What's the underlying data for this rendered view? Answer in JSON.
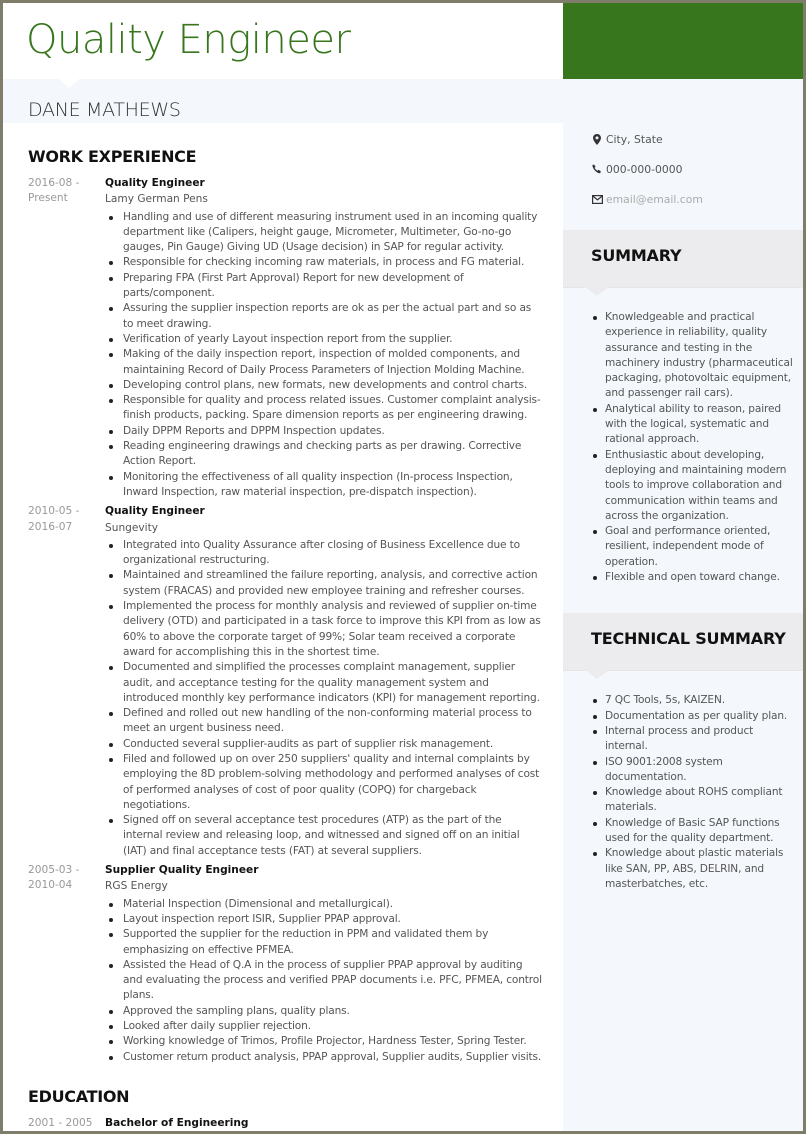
{
  "header": {
    "title": "Quality Engineer",
    "name": "DANE MATHEWS",
    "accent_color": "#38761d"
  },
  "contact": {
    "location": "City, State",
    "phone": "000-000-0000",
    "email": "email@email.com",
    "location_icon": "map-pin-icon",
    "phone_icon": "phone-icon",
    "email_icon": "envelope-icon"
  },
  "work_experience": {
    "heading": "WORK EXPERIENCE",
    "entries": [
      {
        "date_start": "2016-08 -",
        "date_end": "Present",
        "role": "Quality Engineer",
        "company": "Lamy German Pens",
        "bullets": [
          "Handling and use of different measuring instrument used in an incoming quality department like (Calipers, height gauge, Micrometer, Multimeter, Go-no-go gauges, Pin Gauge) Giving UD (Usage decision) in SAP for regular activity.",
          "Responsible for checking incoming raw materials, in process and FG material.",
          "Preparing FPA (First Part Approval) Report for new development of parts/component.",
          "Assuring the supplier inspection reports are ok as per the actual part and so as to meet drawing.",
          "Verification of yearly Layout inspection report from the supplier.",
          "Making of the daily inspection report, inspection of molded components, and maintaining Record of Daily Process Parameters of Injection Molding Machine.",
          "Developing control plans, new formats, new developments and control charts.",
          "Responsible for quality and process related issues. Customer complaint analysis-finish products, packing. Spare dimension reports as per engineering drawing.",
          "Daily DPPM Reports and DPPM Inspection updates.",
          "Reading engineering drawings and checking parts as per drawing. Corrective Action Report.",
          "Monitoring the effectiveness of all quality inspection (In-process Inspection, Inward Inspection, raw material inspection, pre-dispatch inspection)."
        ]
      },
      {
        "date_start": "2010-05 -",
        "date_end": "2016-07",
        "role": "Quality Engineer",
        "company": "Sungevity",
        "bullets": [
          "Integrated into Quality Assurance after closing of Business Excellence due to organizational restructuring.",
          "Maintained and streamlined the failure reporting, analysis, and corrective action system (FRACAS) and provided new employee training and refresher courses.",
          "Implemented the process for monthly analysis and reviewed of supplier on-time delivery (OTD) and participated in a task force to improve this KPI from as low as 60% to above the corporate target of 99%; Solar team received a corporate award for accomplishing this in the shortest time.",
          "Documented and simplified the processes complaint management, supplier audit, and acceptance testing for the quality management system and introduced monthly key performance indicators (KPI) for management reporting.",
          "Defined and rolled out new handling of the non-conforming material process to meet an urgent business need.",
          "Conducted several supplier-audits as part of supplier risk management.",
          "Filed and followed up on over 250 suppliers' quality and internal complaints by employing the 8D problem-solving methodology and performed analyses of cost of performed analyses of cost of poor quality (COPQ) for chargeback negotiations.",
          "Signed off on several acceptance test procedures (ATP) as the part of the internal review and releasing loop, and witnessed and signed off on an initial (IAT) and final acceptance tests (FAT) at several suppliers."
        ]
      },
      {
        "date_start": "2005-03 -",
        "date_end": "2010-04",
        "role": "Supplier Quality Engineer",
        "company": "RGS Energy",
        "bullets": [
          "Material Inspection (Dimensional and metallurgical).",
          "Layout inspection report ISIR, Supplier PPAP approval.",
          "Supported the supplier for the reduction in PPM and validated them by emphasizing on effective PFMEA.",
          "Assisted the Head of Q.A in the process of supplier PPAP approval by auditing and evaluating the process and verified PPAP documents i.e. PFC, PFMEA, control plans.",
          "Approved the sampling plans, quality plans.",
          "Looked after daily supplier rejection.",
          "Working knowledge of Trimos, Profile Projector, Hardness Tester, Spring Tester.",
          "Customer return product analysis, PPAP approval, Supplier audits, Supplier visits."
        ]
      }
    ]
  },
  "education": {
    "heading": "EDUCATION",
    "entries": [
      {
        "date": "2001 - 2005",
        "degree": "Bachelor of Engineering"
      }
    ]
  },
  "summary": {
    "heading": "SUMMARY",
    "bullets": [
      "Knowledgeable and practical experience in reliability, quality assurance and testing in the machinery industry (pharmaceutical packaging, photovoltaic equipment, and passenger rail cars).",
      "Analytical ability to reason, paired with the logical, systematic and rational approach.",
      "Enthusiastic about developing, deploying and maintaining modern tools to improve collaboration and communication within teams and across the organization.",
      "Goal and performance oriented, resilient, independent mode of operation.",
      "Flexible and open toward change."
    ]
  },
  "technical_summary": {
    "heading": "TECHNICAL SUMMARY",
    "bullets": [
      "7 QC Tools, 5s, KAIZEN.",
      "Documentation as per quality plan.",
      "Internal process and product internal.",
      "ISO 9001:2008 system documentation.",
      "Knowledge about ROHS compliant materials.",
      "Knowledge of Basic SAP functions used for the quality department.",
      "Knowledge about plastic materials like SAN, PP, ABS, DELRIN, and masterbatches, etc."
    ]
  }
}
